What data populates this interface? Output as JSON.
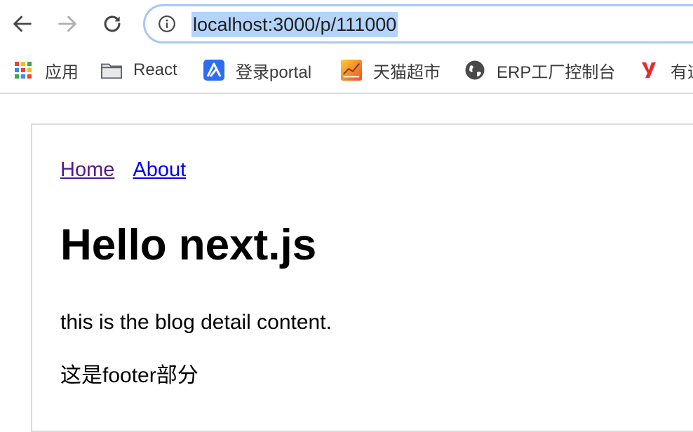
{
  "browser": {
    "url": "localhost:3000/p/111000",
    "bookmarks": [
      {
        "label": "应用",
        "icon": "apps-grid-icon"
      },
      {
        "label": "React",
        "icon": "folder-icon"
      },
      {
        "label": "登录portal",
        "icon": "portal-logo-icon"
      },
      {
        "label": "天猫超市",
        "icon": "tmall-icon"
      },
      {
        "label": "ERP工厂控制台",
        "icon": "globe-icon"
      },
      {
        "label": "有道",
        "icon": "youdao-icon"
      }
    ],
    "colors": {
      "omnibox_border": "#a8c7fa",
      "url_selection": "#b4d4fb"
    }
  },
  "page": {
    "nav": {
      "home": "Home",
      "about": "About"
    },
    "heading": "Hello next.js",
    "content": "this is the blog detail content.",
    "footer": "这是footer部分",
    "colors": {
      "visited_link": "#551a8b",
      "link": "#0000ee"
    }
  }
}
